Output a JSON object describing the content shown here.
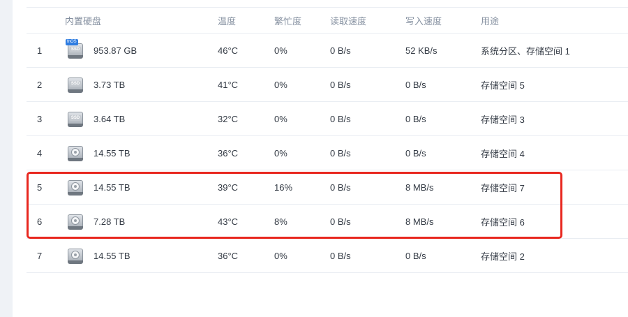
{
  "colors": {
    "highlight": "#e8271f",
    "header_text": "#8590a0",
    "body_text": "#333a44",
    "badge": "#2f7de1"
  },
  "table": {
    "headers": {
      "disk": "内置硬盘",
      "temp": "温度",
      "busy": "繁忙度",
      "read": "读取速度",
      "write": "写入速度",
      "use": "用途"
    },
    "rows": [
      {
        "index": "1",
        "icon": "ssd-icon",
        "badge": "fnOS",
        "size": "953.87 GB",
        "temp": "46°C",
        "busy": "0%",
        "read": "0 B/s",
        "write": "52 KB/s",
        "use": "系统分区、存储空间 1"
      },
      {
        "index": "2",
        "icon": "ssd-icon",
        "size": "3.73 TB",
        "temp": "41°C",
        "busy": "0%",
        "read": "0 B/s",
        "write": "0 B/s",
        "use": "存储空间 5"
      },
      {
        "index": "3",
        "icon": "ssd-icon",
        "size": "3.64 TB",
        "temp": "32°C",
        "busy": "0%",
        "read": "0 B/s",
        "write": "0 B/s",
        "use": "存储空间 3"
      },
      {
        "index": "4",
        "icon": "hdd-icon",
        "size": "14.55 TB",
        "temp": "36°C",
        "busy": "0%",
        "read": "0 B/s",
        "write": "0 B/s",
        "use": "存储空间 4"
      },
      {
        "index": "5",
        "icon": "hdd-icon",
        "size": "14.55 TB",
        "temp": "39°C",
        "busy": "16%",
        "read": "0 B/s",
        "write": "8 MB/s",
        "use": "存储空间 7"
      },
      {
        "index": "6",
        "icon": "hdd-icon",
        "size": "7.28 TB",
        "temp": "43°C",
        "busy": "8%",
        "read": "0 B/s",
        "write": "8 MB/s",
        "use": "存储空间 6"
      },
      {
        "index": "7",
        "icon": "hdd-icon",
        "size": "14.55 TB",
        "temp": "36°C",
        "busy": "0%",
        "read": "0 B/s",
        "write": "0 B/s",
        "use": "存储空间 2"
      }
    ]
  }
}
